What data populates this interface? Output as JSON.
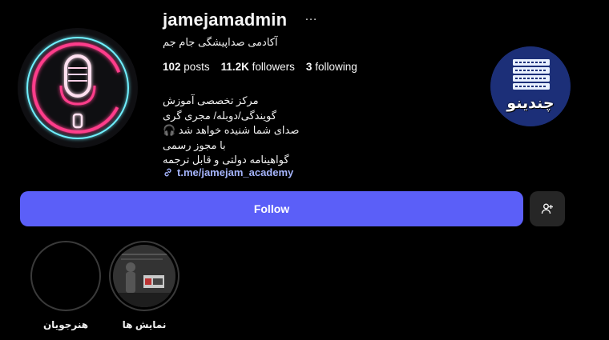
{
  "profile": {
    "username": "jamejamadmin",
    "more_icon": "…",
    "full_name": "آکادمی صداپیشگی جام جم",
    "stats": {
      "posts_value": "102",
      "posts_label": "posts",
      "followers_value": "11.2K",
      "followers_label": "followers",
      "following_value": "3",
      "following_label": "following"
    },
    "bio_lines": [
      "مرکز تخصصی آموزش",
      "گویندگی/دوبله/ مجری گری",
      "صدای شما شنیده خواهد شد 🎧",
      "با مجوز رسمی",
      "گواهینامه دولتی و قابل ترجمه"
    ],
    "link_text": "t.me/jamejam_academy"
  },
  "actions": {
    "follow_label": "Follow",
    "add_user_icon": "add-user-icon"
  },
  "logo": {
    "text": "چندینو"
  },
  "highlights": [
    {
      "label": "هنرجویان"
    },
    {
      "label": "نمایش ها"
    }
  ],
  "colors": {
    "background": "#000000",
    "follow_button": "#5b5ff8",
    "link": "#a5b4fc",
    "neon_pink": "#ff3d8b",
    "neon_cyan": "#6ff0ff"
  }
}
